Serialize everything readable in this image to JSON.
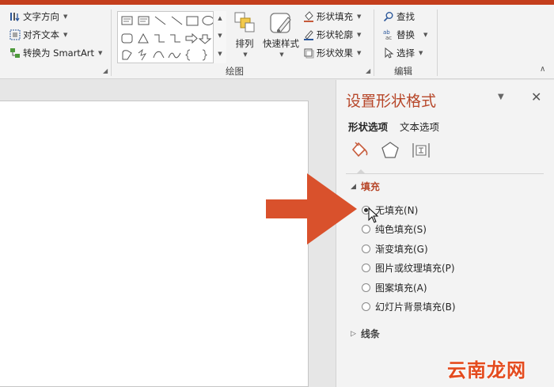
{
  "colors": {
    "accent_bar": "#c43e1c",
    "pane_title": "#b7472a",
    "arrow": "#d9512c",
    "fill_icon": "#c65a3a"
  },
  "ribbon": {
    "text_group": {
      "items": [
        {
          "label": "文字方向",
          "icon": "text-direction-icon"
        },
        {
          "label": "对齐文本",
          "icon": "align-text-icon"
        },
        {
          "label": "转换为 SmartArt",
          "icon": "convert-smartart-icon"
        }
      ]
    },
    "drawing_group": {
      "label": "绘图",
      "arrange_label": "排列",
      "quick_styles_label": "快速样式",
      "shape_fill_label": "形状填充",
      "shape_outline_label": "形状轮廓",
      "shape_effects_label": "形状效果"
    },
    "editing_group": {
      "label": "编辑",
      "find_label": "查找",
      "replace_label": "替换",
      "select_label": "选择"
    }
  },
  "format_pane": {
    "title": "设置形状格式",
    "tabs": [
      "形状选项",
      "文本选项"
    ],
    "categories": [
      "fill-line-icon",
      "effects-icon",
      "size-properties-icon"
    ],
    "fill_section": {
      "label": "填充",
      "options": [
        {
          "label": "无填充(N)",
          "checked": true
        },
        {
          "label": "纯色填充(S)",
          "checked": false
        },
        {
          "label": "渐变填充(G)",
          "checked": false
        },
        {
          "label": "图片或纹理填充(P)",
          "checked": false
        },
        {
          "label": "图案填充(A)",
          "checked": false
        },
        {
          "label": "幻灯片背景填充(B)",
          "checked": false
        }
      ]
    },
    "line_section": {
      "label": "线条"
    }
  },
  "watermark": "云南龙网"
}
